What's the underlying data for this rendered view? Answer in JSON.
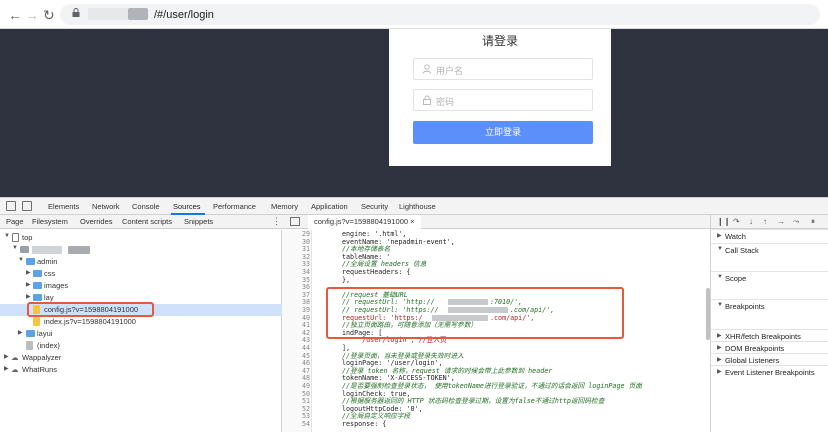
{
  "browser": {
    "back_icon": "arrow-left-icon",
    "forward_icon": "arrow-right-icon",
    "reload_icon": "reload-icon",
    "url_path": "/#/user/login"
  },
  "login": {
    "title": "请登录",
    "username_placeholder": "用户名",
    "password_placeholder": "密码",
    "submit_label": "立即登录"
  },
  "devtools": {
    "tabs": [
      "Elements",
      "Network",
      "Console",
      "Sources",
      "Performance",
      "Memory",
      "Application",
      "Security",
      "Lighthouse"
    ],
    "active_tab": "Sources",
    "navigator_tabs": [
      "Page",
      "Filesystem",
      "Overrides",
      "Content scripts",
      "Snippets"
    ],
    "tree": {
      "top": "top",
      "admin": "admin",
      "css": "css",
      "images": "images",
      "lay": "lay",
      "config_file": "config.js?v=1598804191000",
      "index_file": "index.js?v=1598804191000",
      "layui": "layui",
      "index": "(index)",
      "wappalyzer": "Wappalyzer",
      "whatruns": "WhatRuns"
    },
    "editor_tab": "config.js?v=1598804191000 ×",
    "line_numbers": [
      "29",
      "30",
      "31",
      "32",
      "33",
      "34",
      "35",
      "36",
      "37",
      "38",
      "39",
      "40",
      "41",
      "42",
      "43",
      "44",
      "45",
      "46",
      "47",
      "48",
      "49",
      "50",
      "51",
      "52",
      "53",
      "54"
    ],
    "code_lines": [
      "engine: '.html',",
      "eventName: 'nepadmin-event',",
      "//本地存储表名",
      "tableName: '",
      "//全局设置 headers 信息",
      "requestHeaders: {",
      "},",
      "",
      "//request 基础URL",
      "// requestUrl: 'http://",
      "// requestUrl: 'https://",
      "requestUrl: 'https:/",
      "//独立页面路由，可随意添加（无需写参数）",
      "indPage: [",
      "    '/user/login', //登入页",
      "],",
      "//登录页面，当未登录或登录失效时进入",
      "loginPage: '/user/login',",
      "//登录 token 名称，request 请求的时候会带上此参数到 header",
      "tokenName: 'X-ACCESS-TOKEN',",
      "//是否要强制检查登录状态， 使用tokenName进行登录验证，不通过的话会返回 loginPage 页面",
      "loginCheck: true,",
      "//根据服务器返回的 HTTP 状态码检查登录过期，设置为false不通过http返回码检查",
      "logoutHttpCode: '0',",
      "//全局自定义响应字段",
      "response: {"
    ],
    "code_suffixes": {
      "line38": ":7010/',",
      "line39": ".com/api/',",
      "line40": ".com/api/',"
    },
    "right_sections": [
      "Watch",
      "Call Stack",
      "Scope",
      "Breakpoints",
      "XHR/fetch Breakpoints",
      "DOM Breakpoints",
      "Global Listeners",
      "Event Listener Breakpoints"
    ]
  },
  "colors": {
    "page_bg": "#2f3340",
    "button_blue": "#5b8ff9",
    "highlight_red": "#e65a3a",
    "selected_row": "#cfe1fb"
  }
}
